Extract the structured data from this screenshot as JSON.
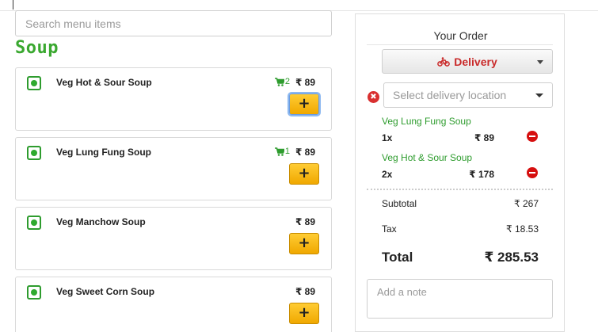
{
  "search": {
    "placeholder": "Search menu items"
  },
  "section": {
    "title": "Soup"
  },
  "menu_items": [
    {
      "name": "Veg Hot & Sour Soup",
      "price": "₹ 89",
      "in_cart": "2",
      "add_label": "+"
    },
    {
      "name": "Veg Lung Fung Soup",
      "price": "₹ 89",
      "in_cart": "1",
      "add_label": "+"
    },
    {
      "name": "Veg Manchow Soup",
      "price": "₹ 89",
      "add_label": "+"
    },
    {
      "name": "Veg Sweet Corn Soup",
      "price": "₹ 89",
      "add_label": "+"
    }
  ],
  "order": {
    "title": "Your Order",
    "mode_label": "Delivery",
    "location_placeholder": "Select delivery location",
    "items": [
      {
        "name": "Veg Lung Fung Soup",
        "qty": "1x",
        "price": "₹ 89"
      },
      {
        "name": "Veg Hot & Sour Soup",
        "qty": "2x",
        "price": "₹ 178"
      }
    ],
    "subtotal_label": "Subtotal",
    "subtotal": "₹ 267",
    "tax_label": "Tax",
    "tax": "₹ 18.53",
    "total_label": "Total",
    "total": "₹ 285.53",
    "note_placeholder": "Add a note"
  },
  "colors": {
    "accent_green": "#3aa830",
    "add_button": "#f0a800",
    "delivery_red": "#c92a2a",
    "remove_red": "#d60f0f"
  },
  "icons": {
    "veg": "veg-indicator-icon",
    "cart": "cart-icon",
    "bike": "bike-icon",
    "error": "error-icon",
    "remove": "remove-icon"
  }
}
